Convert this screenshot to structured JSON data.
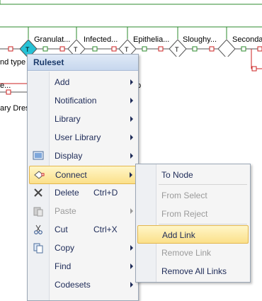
{
  "diagram": {
    "nodes": [
      {
        "label": "Granulat..."
      },
      {
        "label": "Infected..."
      },
      {
        "label": "Epithelia..."
      },
      {
        "label": "Sloughy..."
      },
      {
        "label": "Seconda"
      }
    ],
    "left_labels": {
      "row1": "nd type",
      "row2": "e...",
      "row3": "ary Dress",
      "stray": "p"
    },
    "gate_letter": "T",
    "colors": {
      "line_green": "#2e8b2e",
      "line_red": "#cc2222",
      "selected_node": "#26c2d6"
    }
  },
  "context_menu": {
    "title": "Ruleset",
    "items": [
      {
        "label": "Add",
        "shortcut": "",
        "submenu": true,
        "disabled": false
      },
      {
        "label": "Notification",
        "shortcut": "",
        "submenu": true,
        "disabled": false
      },
      {
        "label": "Library",
        "shortcut": "",
        "submenu": true,
        "disabled": false
      },
      {
        "label": "User Library",
        "shortcut": "",
        "submenu": true,
        "disabled": false
      },
      {
        "label": "Display",
        "shortcut": "",
        "submenu": true,
        "disabled": false,
        "icon": "display-icon"
      },
      {
        "label": "Connect",
        "shortcut": "",
        "submenu": true,
        "disabled": false,
        "highlighted": true,
        "icon": "connect-icon"
      },
      {
        "label": "Delete",
        "shortcut": "Ctrl+D",
        "submenu": false,
        "disabled": false,
        "icon": "delete-icon"
      },
      {
        "label": "Paste",
        "shortcut": "",
        "submenu": true,
        "disabled": true,
        "icon": "paste-icon"
      },
      {
        "label": "Cut",
        "shortcut": "Ctrl+X",
        "submenu": false,
        "disabled": false,
        "icon": "cut-icon"
      },
      {
        "label": "Copy",
        "shortcut": "",
        "submenu": true,
        "disabled": false,
        "icon": "copy-icon"
      },
      {
        "label": "Find",
        "shortcut": "",
        "submenu": true,
        "disabled": false
      },
      {
        "label": "Codesets",
        "shortcut": "",
        "submenu": true,
        "disabled": false
      }
    ]
  },
  "connect_submenu": {
    "items": [
      {
        "label": "To Node",
        "disabled": false
      },
      {
        "label": "From Select",
        "disabled": true
      },
      {
        "label": "From Reject",
        "disabled": true
      },
      {
        "label": "Add Link",
        "disabled": false,
        "highlighted": true
      },
      {
        "label": "Remove Link",
        "disabled": true
      },
      {
        "label": "Remove All Links",
        "disabled": false
      }
    ]
  }
}
